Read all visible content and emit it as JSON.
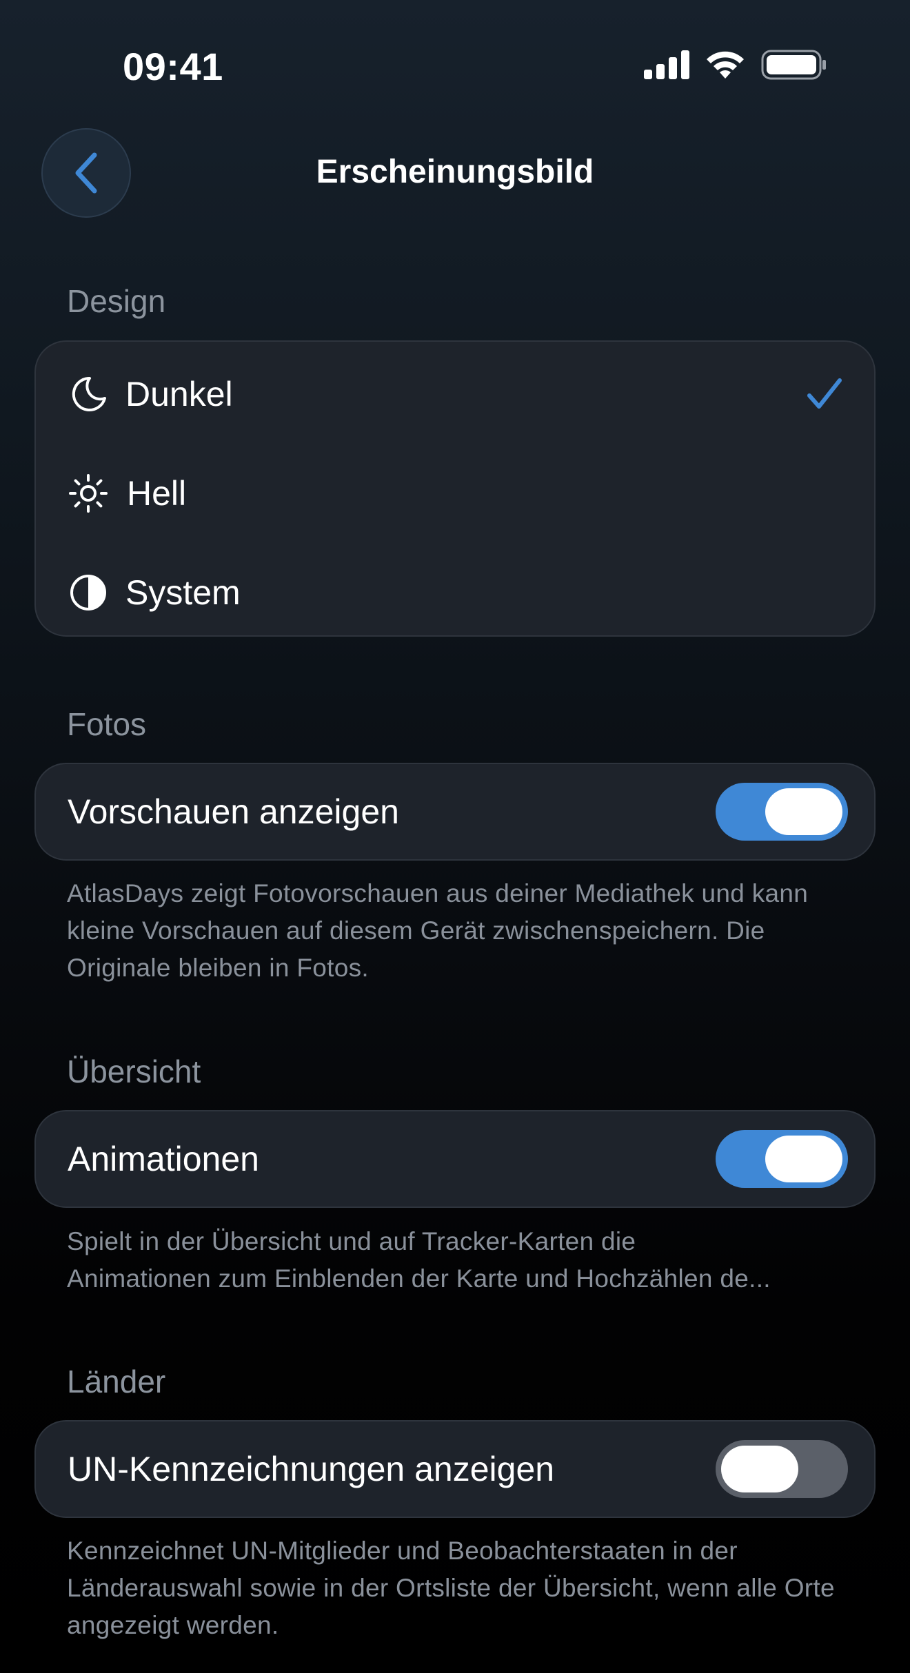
{
  "status_bar": {
    "time": "09:41",
    "signal_icon": "cellular-signal-icon",
    "wifi_icon": "wifi-icon",
    "battery_icon": "battery-icon"
  },
  "nav": {
    "back_icon": "chevron-left-icon",
    "title": "Erscheinungsbild"
  },
  "design": {
    "section_label": "Design",
    "options": [
      {
        "label": "Dunkel",
        "icon": "moon-icon",
        "selected": true
      },
      {
        "label": "Hell",
        "icon": "sun-icon",
        "selected": false
      },
      {
        "label": "System",
        "icon": "half-circle-icon",
        "selected": false
      }
    ]
  },
  "fotos": {
    "section_label": "Fotos",
    "toggle_label": "Vorschauen anzeigen",
    "toggle_on": true,
    "footnote": "AtlasDays zeigt Fotovorschauen aus deiner Mediathek und kann kleine Vorschauen auf diesem Gerät zwischenspeichern. Die Originale bleiben in Fotos."
  },
  "uebersicht": {
    "section_label": "Übersicht",
    "toggle_label": "Animationen",
    "toggle_on": true,
    "footnote_line1": "Spielt in der Übersicht und auf Tracker-Karten die",
    "footnote_line2": "Animationen zum Einblenden der Karte und Hochzählen de..."
  },
  "laender": {
    "section_label": "Länder",
    "toggle_label": "UN-Kennzeichnungen anzeigen",
    "toggle_on": false,
    "footnote": "Kennzeichnet UN-Mitglieder und Beobachterstaaten in der Länderauswahl sowie in der Ortsliste der Übersicht, wenn alle Orte angezeigt werden."
  },
  "colors": {
    "accent": "#3f88d6",
    "card_background": "#1e232b",
    "secondary_text": "#8a919b"
  }
}
